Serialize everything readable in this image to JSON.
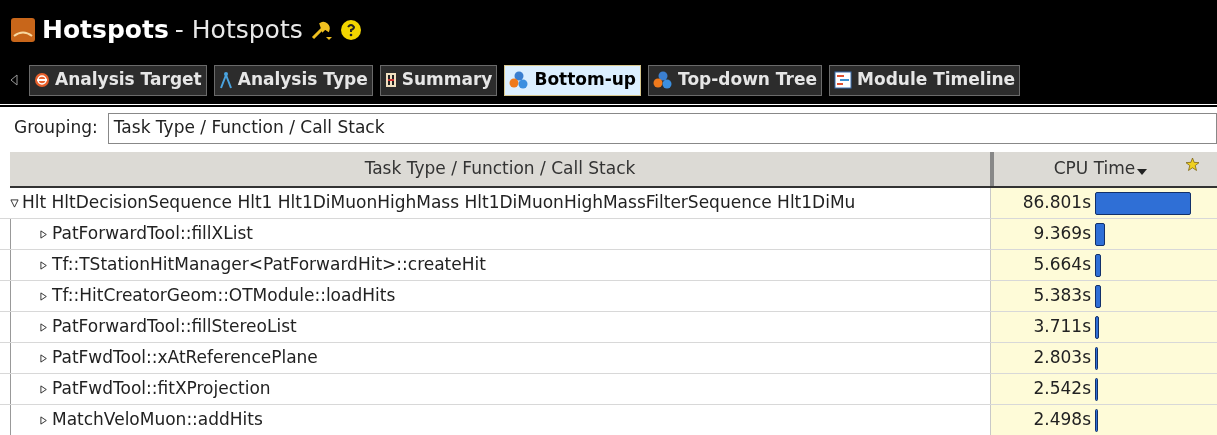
{
  "window": {
    "title": "Hotspots",
    "subtitle": "- Hotspots"
  },
  "tabs": [
    {
      "label": "Analysis Target",
      "kind": "target",
      "selected": false
    },
    {
      "label": "Analysis Type",
      "kind": "compass",
      "selected": false
    },
    {
      "label": "Summary",
      "kind": "summary",
      "selected": false
    },
    {
      "label": "Bottom-up",
      "kind": "spheres",
      "selected": true
    },
    {
      "label": "Top-down Tree",
      "kind": "spheres",
      "selected": false
    },
    {
      "label": "Module Timeline",
      "kind": "timeline",
      "selected": false
    }
  ],
  "grouping": {
    "label": "Grouping:",
    "value": "Task Type / Function / Call Stack"
  },
  "table": {
    "columns": [
      "Task Type / Function / Call Stack",
      "CPU Time"
    ],
    "rows": [
      {
        "name": "Hlt HltDecisionSequence Hlt1 Hlt1DiMuonHighMass Hlt1DiMuonHighMassFilterSequence Hlt1DiMu",
        "cpu_time": "86.801s",
        "expanded": true,
        "children": [
          {
            "name": "PatForwardTool::fillXList",
            "cpu_time": "9.369s",
            "expanded": false
          },
          {
            "name": "Tf::TStationHitManager<PatForwardHit>::createHit",
            "cpu_time": "5.664s",
            "expanded": false
          },
          {
            "name": "Tf::HitCreatorGeom::OTModule::loadHits",
            "cpu_time": "5.383s",
            "expanded": false
          },
          {
            "name": "PatForwardTool::fillStereoList",
            "cpu_time": "3.711s",
            "expanded": false
          },
          {
            "name": "PatFwdTool::xAtReferencePlane",
            "cpu_time": "2.803s",
            "expanded": false
          },
          {
            "name": "PatFwdTool::fitXProjection",
            "cpu_time": "2.542s",
            "expanded": false
          },
          {
            "name": "MatchVeloMuon::addHits",
            "cpu_time": "2.498s",
            "expanded": false
          }
        ]
      }
    ]
  }
}
